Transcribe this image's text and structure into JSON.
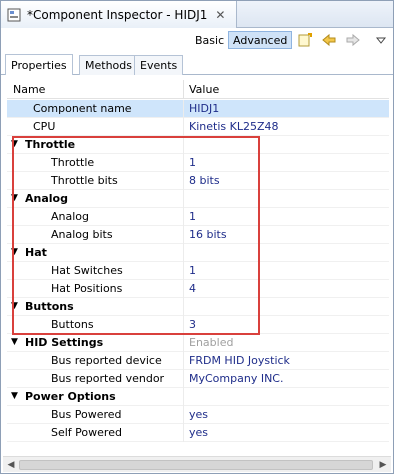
{
  "window": {
    "title": "*Component Inspector - HIDJ1",
    "close_glyph": "✕"
  },
  "toolbar": {
    "basic_label": "Basic",
    "advanced_label": "Advanced"
  },
  "subtabs": [
    {
      "label": "Properties"
    },
    {
      "label": "Methods"
    },
    {
      "label": "Events"
    }
  ],
  "table": {
    "header_name": "Name",
    "header_value": "Value",
    "rows": [
      {
        "name": "Component name",
        "value": "HIDJ1"
      },
      {
        "name": "CPU",
        "value": "Kinetis KL25Z48"
      },
      {
        "name": "Throttle",
        "value": ""
      },
      {
        "name": "Throttle",
        "value": "1"
      },
      {
        "name": "Throttle bits",
        "value": "8 bits"
      },
      {
        "name": "Analog",
        "value": ""
      },
      {
        "name": "Analog",
        "value": "1"
      },
      {
        "name": "Analog bits",
        "value": "16 bits"
      },
      {
        "name": "Hat",
        "value": ""
      },
      {
        "name": "Hat Switches",
        "value": "1"
      },
      {
        "name": "Hat Positions",
        "value": "4"
      },
      {
        "name": "Buttons",
        "value": ""
      },
      {
        "name": "Buttons",
        "value": "3"
      },
      {
        "name": "HID Settings",
        "value": "Enabled"
      },
      {
        "name": "Bus reported device",
        "value": "FRDM HID Joystick"
      },
      {
        "name": "Bus reported vendor",
        "value": "MyCompany INC."
      },
      {
        "name": "Power Options",
        "value": ""
      },
      {
        "name": "Bus Powered",
        "value": "yes"
      },
      {
        "name": "Self Powered",
        "value": "yes"
      }
    ]
  },
  "colors": {
    "highlight": "#d9403c",
    "value_text": "#1f2d8a",
    "selected_row": "#cfe5fb"
  }
}
